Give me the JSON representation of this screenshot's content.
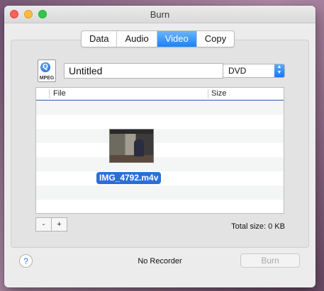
{
  "window": {
    "title": "Burn"
  },
  "tabs": [
    {
      "label": "Data"
    },
    {
      "label": "Audio"
    },
    {
      "label": "Video",
      "active": true
    },
    {
      "label": "Copy"
    }
  ],
  "disc": {
    "icon": "mpeg-file-icon",
    "icon_label": "MPEG",
    "name_value": "Untitled"
  },
  "format_select": {
    "value": "DVD"
  },
  "table": {
    "columns": [
      "File",
      "Size"
    ],
    "files": [
      {
        "name": "IMG_4792.m4v"
      }
    ]
  },
  "controls": {
    "remove_label": "-",
    "add_label": "+"
  },
  "total_size": "Total size: 0 KB",
  "footer": {
    "help_label": "?",
    "status": "No Recorder",
    "burn_label": "Burn"
  },
  "colors": {
    "accent": "#1a82fb",
    "selection": "#2a6fd6"
  }
}
